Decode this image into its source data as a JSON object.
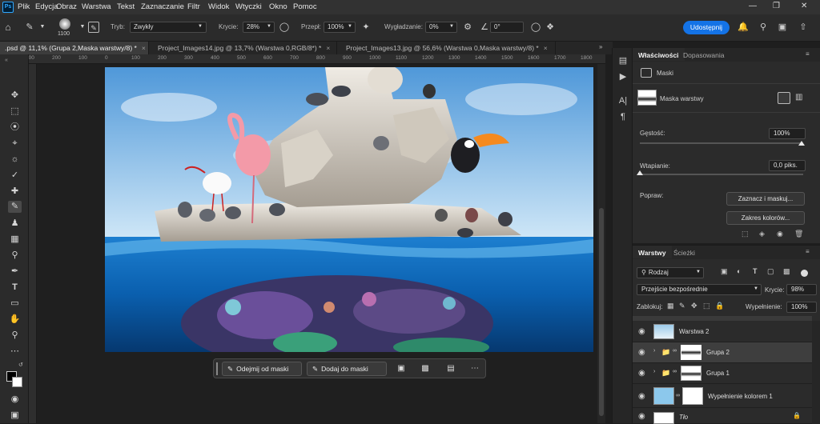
{
  "menu": [
    "Plik",
    "Edycja",
    "Obraz",
    "Warstwa",
    "Tekst",
    "Zaznaczanie",
    "Filtr",
    "Widok",
    "Wtyczki",
    "Okno",
    "Pomoc"
  ],
  "options": {
    "brush_size": "1100",
    "mode_label": "Tryb:",
    "mode_value": "Zwykły",
    "opacity_label": "Krycie:",
    "opacity_value": "28%",
    "flow_label": "Przepł:",
    "flow_value": "100%",
    "smoothing_label": "Wygładzanie:",
    "smoothing_value": "0%",
    "angle_value": "0°",
    "share_label": "Udostępnij"
  },
  "tabs": [
    {
      "label": ".psd @ 11,1% (Grupa 2,Maska warstwy/8) *",
      "active": true
    },
    {
      "label": "Project_Images14.jpg @ 13,7% (Warstwa 0,RGB/8*) *",
      "active": false
    },
    {
      "label": "Project_Images13.jpg @ 56,6% (Warstwa 0,Maska warstwy/8) *",
      "active": false
    }
  ],
  "ruler": [
    "300",
    "200",
    "100",
    "0",
    "100",
    "200",
    "300",
    "400",
    "500",
    "600",
    "700",
    "800",
    "900",
    "1000",
    "1100",
    "1200",
    "1300",
    "1400",
    "1500",
    "1600",
    "1700",
    "1800"
  ],
  "context_bar": {
    "subtract_label": "Odejmij od maski",
    "add_label": "Dodaj do maski"
  },
  "properties": {
    "tab_active": "Właściwości",
    "tab_other": "Dopasowania",
    "section_label": "Maski",
    "mask_label": "Maska warstwy",
    "density_label": "Gęstość:",
    "density_value": "100%",
    "density_level": 1.0,
    "feather_label": "Wtapianie:",
    "feather_value": "0,0 piks.",
    "feather_level": 0.0,
    "refine_label": "Popraw:",
    "select_mask_button": "Zaznacz i maskuj...",
    "color_range_button": "Zakres kolorów..."
  },
  "layers_panel": {
    "tab_active": "Warstwy",
    "tab_other": "Ścieżki",
    "filter_label": "Rodzaj",
    "blend_mode": "Przejście bezpośrednie",
    "opacity_label": "Krycie:",
    "opacity_value": "98%",
    "lock_label": "Zablokuj:",
    "fill_label": "Wypełnienie:",
    "fill_value": "100%",
    "layers": [
      {
        "name": "Warstwa 2",
        "type": "image"
      },
      {
        "name": "Grupa 2",
        "type": "group",
        "selected": true
      },
      {
        "name": "Grupa 1",
        "type": "group"
      },
      {
        "name": "Wypełnienie kolorem 1",
        "type": "fill"
      },
      {
        "name": "Tło",
        "type": "background"
      }
    ]
  },
  "colors": {
    "accent": "#1473e6",
    "panel": "#2b2b2b",
    "sky": "#8cc8ec",
    "water": "#0a5fae"
  }
}
